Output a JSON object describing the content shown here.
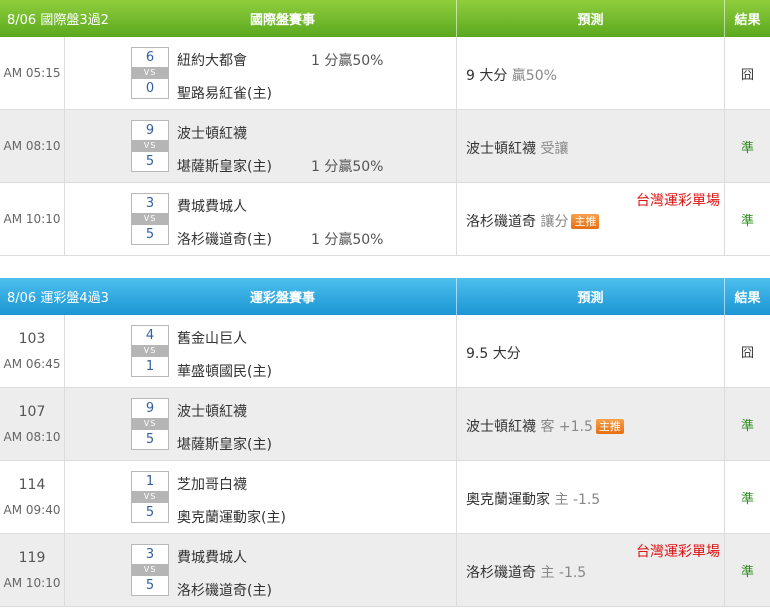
{
  "colors": {
    "green_header": "#6cb92a",
    "blue_header": "#25a3dc",
    "hit": "#2e8b1e",
    "tag": "#dd1111",
    "badge": "#ee8420"
  },
  "sections": [
    {
      "theme": "green",
      "header": {
        "date": "8/06 國際盤3過2",
        "game": "國際盤賽事",
        "prediction": "預測",
        "result": "結果"
      },
      "rows": [
        {
          "num": "",
          "time": "AM 05:15",
          "score1": "6",
          "score2": "0",
          "vs": "VS",
          "team1": "紐約大都會",
          "team2": "聖路易紅雀(主)",
          "hcap1": "1 分贏50%",
          "hcap2": "",
          "pred_main": "9 大分",
          "pred_sub": " 贏50%",
          "badge": "",
          "tag": "",
          "result": "囧",
          "hit": false
        },
        {
          "num": "",
          "time": "AM 08:10",
          "score1": "9",
          "score2": "5",
          "vs": "VS",
          "team1": "波士頓紅襪",
          "team2": "堪薩斯皇家(主)",
          "hcap1": "",
          "hcap2": "1 分贏50%",
          "pred_main": "波士頓紅襪",
          "pred_sub": " 受讓",
          "badge": "",
          "tag": "",
          "result": "準",
          "hit": true
        },
        {
          "num": "",
          "time": "AM 10:10",
          "score1": "3",
          "score2": "5",
          "vs": "VS",
          "team1": "費城費城人",
          "team2": "洛杉磯道奇(主)",
          "hcap1": "",
          "hcap2": "1 分贏50%",
          "pred_main": "洛杉磯道奇",
          "pred_sub": " 讓分",
          "badge": "主推",
          "tag": "台灣運彩單場",
          "result": "準",
          "hit": true
        }
      ]
    },
    {
      "theme": "blue",
      "header": {
        "date": "8/06 運彩盤4過3",
        "game": "運彩盤賽事",
        "prediction": "預測",
        "result": "結果"
      },
      "rows": [
        {
          "num": "103",
          "time": "AM 06:45",
          "score1": "4",
          "score2": "1",
          "vs": "VS",
          "team1": "舊金山巨人",
          "team2": "華盛頓國民(主)",
          "hcap1": "",
          "hcap2": "",
          "pred_main": "9.5 大分",
          "pred_sub": "",
          "badge": "",
          "tag": "",
          "result": "囧",
          "hit": false
        },
        {
          "num": "107",
          "time": "AM 08:10",
          "score1": "9",
          "score2": "5",
          "vs": "VS",
          "team1": "波士頓紅襪",
          "team2": "堪薩斯皇家(主)",
          "hcap1": "",
          "hcap2": "",
          "pred_main": "波士頓紅襪",
          "pred_sub": " 客 +1.5",
          "badge": "主推",
          "tag": "",
          "result": "準",
          "hit": true
        },
        {
          "num": "114",
          "time": "AM 09:40",
          "score1": "1",
          "score2": "5",
          "vs": "VS",
          "team1": "芝加哥白襪",
          "team2": "奧克蘭運動家(主)",
          "hcap1": "",
          "hcap2": "",
          "pred_main": "奧克蘭運動家",
          "pred_sub": " 主 -1.5",
          "badge": "",
          "tag": "",
          "result": "準",
          "hit": true
        },
        {
          "num": "119",
          "time": "AM 10:10",
          "score1": "3",
          "score2": "5",
          "vs": "VS",
          "team1": "費城費城人",
          "team2": "洛杉磯道奇(主)",
          "hcap1": "",
          "hcap2": "",
          "pred_main": "洛杉磯道奇",
          "pred_sub": " 主 -1.5",
          "badge": "",
          "tag": "台灣運彩單場",
          "result": "準",
          "hit": true
        }
      ]
    }
  ]
}
